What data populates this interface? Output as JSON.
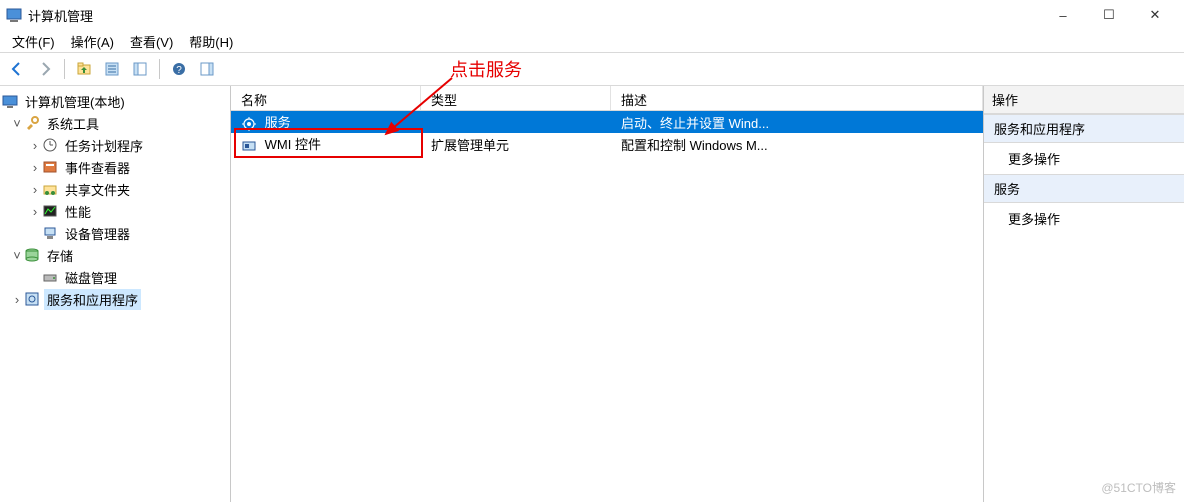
{
  "window": {
    "title": "计算机管理"
  },
  "annotation": {
    "label": "点击服务"
  },
  "window_controls": {
    "min": "–",
    "max": "☐",
    "close": "✕"
  },
  "menubar": [
    {
      "label": "文件(F)"
    },
    {
      "label": "操作(A)"
    },
    {
      "label": "查看(V)"
    },
    {
      "label": "帮助(H)"
    }
  ],
  "toolbar": {
    "back": "←",
    "forward": "→",
    "up": "↑",
    "props": "☰",
    "details": "≣",
    "refresh": "⟳",
    "help": "?",
    "toggle": "☐"
  },
  "tree": {
    "root": "计算机管理(本地)",
    "systools": "系统工具",
    "tasksched": "任务计划程序",
    "eventvwr": "事件查看器",
    "shared": "共享文件夹",
    "perf": "性能",
    "devicemgr": "设备管理器",
    "storage": "存储",
    "diskmgr": "磁盘管理",
    "services_apps": "服务和应用程序"
  },
  "list": {
    "columns": [
      "名称",
      "类型",
      "描述"
    ],
    "rows": [
      {
        "name": "服务",
        "type": "",
        "desc": "启动、终止并设置 Wind...",
        "selected": true
      },
      {
        "name": "WMI 控件",
        "type": "扩展管理单元",
        "desc": "配置和控制 Windows M...",
        "selected": false
      }
    ]
  },
  "actions": {
    "header": "操作",
    "group1": "服务和应用程序",
    "more1": "更多操作",
    "group2": "服务",
    "more2": "更多操作"
  },
  "watermark": "@51CTO博客"
}
